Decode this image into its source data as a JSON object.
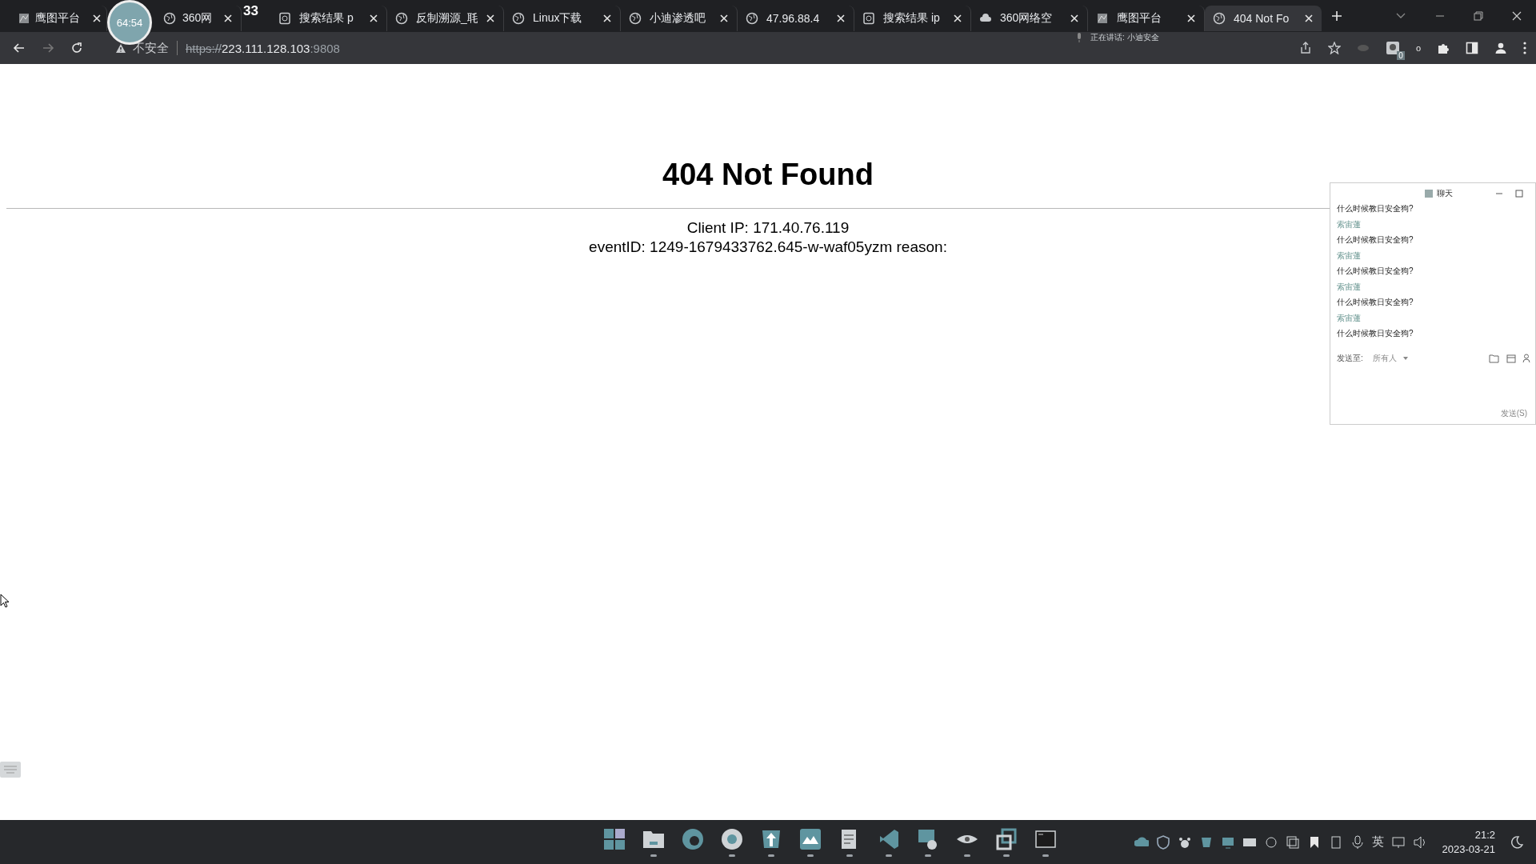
{
  "browser": {
    "tabs": [
      {
        "title": "鹰图平台",
        "selected": false
      },
      {
        "title": "360网",
        "selected": false
      },
      {
        "title": "搜索结果 p",
        "selected": false
      },
      {
        "title": "反制溯源_毦",
        "selected": false
      },
      {
        "title": "Linux下载",
        "selected": false
      },
      {
        "title": "小迪渗透吧",
        "selected": false
      },
      {
        "title": "47.96.88.4",
        "selected": false
      },
      {
        "title": "搜索结果 ip",
        "selected": false
      },
      {
        "title": "360网络空",
        "selected": false
      },
      {
        "title": "鹰图平台",
        "selected": false
      },
      {
        "title": "404 Not Fo",
        "selected": true
      }
    ],
    "recording_timer": "64:54",
    "counter": "33",
    "speaking": "正在讲话: 小迪安全",
    "security_label": "不安全",
    "url": {
      "scheme": "https://",
      "host": "223.111.128.103",
      "port": ":9808"
    },
    "extension_badge": "0",
    "extension_label": "o"
  },
  "page": {
    "heading": "404 Not Found",
    "lines": [
      "Client IP: 171.40.76.119",
      "eventID: 1249-1679433762.645-w-waf05yzm reason:"
    ]
  },
  "chat": {
    "title": "聊天",
    "messages": [
      {
        "kind": "question",
        "text": "什么时候教日安全狗?"
      },
      {
        "kind": "name",
        "text": "索宙蓮"
      },
      {
        "kind": "question",
        "text": "什么时候教日安全狗?"
      },
      {
        "kind": "name",
        "text": "索宙蓮"
      },
      {
        "kind": "question",
        "text": "什么时候教日安全狗?"
      },
      {
        "kind": "name",
        "text": "索宙蓮"
      },
      {
        "kind": "question",
        "text": "什么时候教日安全狗?"
      },
      {
        "kind": "name",
        "text": "索宙蓮"
      },
      {
        "kind": "question",
        "text": "什么时候教日安全狗?"
      }
    ],
    "send_to_label": "发送至:",
    "recipient": "所有人",
    "send_button": "发送(S)"
  },
  "taskbar": {
    "apps": [
      {
        "running": false
      },
      {
        "running": true
      },
      {
        "running": false
      },
      {
        "running": true
      },
      {
        "running": true
      },
      {
        "running": true
      },
      {
        "running": true
      },
      {
        "running": true
      },
      {
        "running": true
      },
      {
        "running": true
      },
      {
        "running": true
      },
      {
        "running": true
      }
    ],
    "input_language": "英",
    "time": "21:2",
    "date": "2023-03-21"
  }
}
